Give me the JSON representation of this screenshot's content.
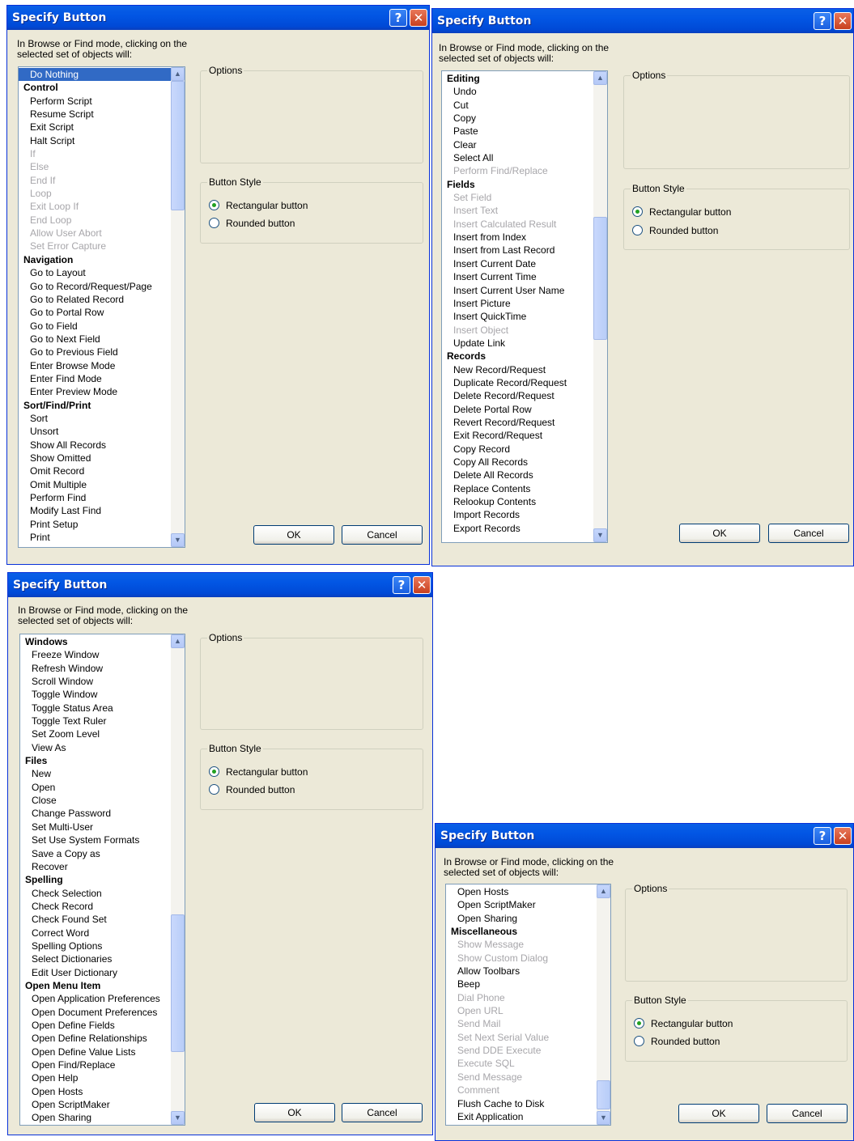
{
  "dialog_title": "Specify Button",
  "prompt": "In Browse or Find mode, clicking on the selected set of objects will:",
  "options_label": "Options",
  "button_style_label": "Button Style",
  "radio_rect": "Rectangular button",
  "radio_round": "Rounded button",
  "ok_label": "OK",
  "cancel_label": "Cancel",
  "help_glyph": "?",
  "close_glyph": "✕",
  "colors": {
    "titlebar": "#0054e3",
    "dialog_bg": "#ece9d8",
    "selection": "#316ac5"
  },
  "dialogs": [
    {
      "items": [
        {
          "text": "Do Nothing",
          "kind": "sel"
        },
        {
          "text": "Control",
          "kind": "hdr"
        },
        {
          "text": "Perform Script"
        },
        {
          "text": "Resume Script"
        },
        {
          "text": "Exit Script"
        },
        {
          "text": "Halt Script"
        },
        {
          "text": "If",
          "kind": "dis"
        },
        {
          "text": "Else",
          "kind": "dis"
        },
        {
          "text": "End If",
          "kind": "dis"
        },
        {
          "text": "Loop",
          "kind": "dis"
        },
        {
          "text": "Exit Loop If",
          "kind": "dis"
        },
        {
          "text": "End Loop",
          "kind": "dis"
        },
        {
          "text": "Allow User Abort",
          "kind": "dis"
        },
        {
          "text": "Set Error Capture",
          "kind": "dis"
        },
        {
          "text": "Navigation",
          "kind": "hdr"
        },
        {
          "text": "Go to Layout"
        },
        {
          "text": "Go to Record/Request/Page"
        },
        {
          "text": "Go to Related Record"
        },
        {
          "text": "Go to Portal Row"
        },
        {
          "text": "Go to Field"
        },
        {
          "text": "Go to Next Field"
        },
        {
          "text": "Go to Previous Field"
        },
        {
          "text": "Enter Browse Mode"
        },
        {
          "text": "Enter Find Mode"
        },
        {
          "text": "Enter Preview Mode"
        },
        {
          "text": "Sort/Find/Print",
          "kind": "hdr"
        },
        {
          "text": "Sort"
        },
        {
          "text": "Unsort"
        },
        {
          "text": "Show All Records"
        },
        {
          "text": "Show Omitted"
        },
        {
          "text": "Omit Record"
        },
        {
          "text": "Omit Multiple"
        },
        {
          "text": "Perform Find"
        },
        {
          "text": "Modify Last Find"
        },
        {
          "text": "Print Setup"
        },
        {
          "text": "Print"
        }
      ]
    },
    {
      "items": [
        {
          "text": "Editing",
          "kind": "hdr"
        },
        {
          "text": "Undo"
        },
        {
          "text": "Cut"
        },
        {
          "text": "Copy"
        },
        {
          "text": "Paste"
        },
        {
          "text": "Clear"
        },
        {
          "text": "Select All"
        },
        {
          "text": "Perform Find/Replace",
          "kind": "dis"
        },
        {
          "text": "Fields",
          "kind": "hdr"
        },
        {
          "text": "Set Field",
          "kind": "dis"
        },
        {
          "text": "Insert Text",
          "kind": "dis"
        },
        {
          "text": "Insert Calculated Result",
          "kind": "dis"
        },
        {
          "text": "Insert from Index"
        },
        {
          "text": "Insert from Last Record"
        },
        {
          "text": "Insert Current Date"
        },
        {
          "text": "Insert Current Time"
        },
        {
          "text": "Insert Current User Name"
        },
        {
          "text": "Insert Picture"
        },
        {
          "text": "Insert QuickTime"
        },
        {
          "text": "Insert Object",
          "kind": "dis"
        },
        {
          "text": "Update Link"
        },
        {
          "text": "Records",
          "kind": "hdr"
        },
        {
          "text": "New Record/Request"
        },
        {
          "text": "Duplicate Record/Request"
        },
        {
          "text": "Delete Record/Request"
        },
        {
          "text": "Delete Portal Row"
        },
        {
          "text": "Revert Record/Request"
        },
        {
          "text": "Exit Record/Request"
        },
        {
          "text": "Copy Record"
        },
        {
          "text": "Copy All Records"
        },
        {
          "text": "Delete All Records"
        },
        {
          "text": "Replace Contents"
        },
        {
          "text": "Relookup Contents"
        },
        {
          "text": "Import Records"
        },
        {
          "text": "Export Records"
        }
      ]
    },
    {
      "items": [
        {
          "text": "Windows",
          "kind": "hdr"
        },
        {
          "text": "Freeze Window"
        },
        {
          "text": "Refresh Window"
        },
        {
          "text": "Scroll Window"
        },
        {
          "text": "Toggle Window"
        },
        {
          "text": "Toggle Status Area"
        },
        {
          "text": "Toggle Text Ruler"
        },
        {
          "text": "Set Zoom Level"
        },
        {
          "text": "View As"
        },
        {
          "text": "Files",
          "kind": "hdr"
        },
        {
          "text": "New"
        },
        {
          "text": "Open"
        },
        {
          "text": "Close"
        },
        {
          "text": "Change Password"
        },
        {
          "text": "Set Multi-User"
        },
        {
          "text": "Set Use System Formats"
        },
        {
          "text": "Save a Copy as"
        },
        {
          "text": "Recover"
        },
        {
          "text": "Spelling",
          "kind": "hdr"
        },
        {
          "text": "Check Selection"
        },
        {
          "text": "Check Record"
        },
        {
          "text": "Check Found Set"
        },
        {
          "text": "Correct Word"
        },
        {
          "text": "Spelling Options"
        },
        {
          "text": "Select Dictionaries"
        },
        {
          "text": "Edit User Dictionary"
        },
        {
          "text": "Open Menu Item",
          "kind": "hdr"
        },
        {
          "text": "Open Application Preferences"
        },
        {
          "text": "Open Document Preferences"
        },
        {
          "text": "Open Define Fields"
        },
        {
          "text": "Open Define Relationships"
        },
        {
          "text": "Open Define Value Lists"
        },
        {
          "text": "Open Find/Replace"
        },
        {
          "text": "Open Help"
        },
        {
          "text": "Open Hosts"
        },
        {
          "text": "Open ScriptMaker"
        },
        {
          "text": "Open Sharing"
        }
      ]
    },
    {
      "items": [
        {
          "text": "Open Hosts"
        },
        {
          "text": "Open ScriptMaker"
        },
        {
          "text": "Open Sharing"
        },
        {
          "text": "Miscellaneous",
          "kind": "hdr"
        },
        {
          "text": "Show Message",
          "kind": "dis"
        },
        {
          "text": "Show Custom Dialog",
          "kind": "dis"
        },
        {
          "text": "Allow Toolbars"
        },
        {
          "text": "Beep"
        },
        {
          "text": "Dial Phone",
          "kind": "dis"
        },
        {
          "text": "Open URL",
          "kind": "dis"
        },
        {
          "text": "Send Mail",
          "kind": "dis"
        },
        {
          "text": "Set Next Serial Value",
          "kind": "dis"
        },
        {
          "text": "Send DDE Execute",
          "kind": "dis"
        },
        {
          "text": "Execute SQL",
          "kind": "dis"
        },
        {
          "text": "Send Message",
          "kind": "dis"
        },
        {
          "text": "Comment",
          "kind": "dis"
        },
        {
          "text": "Flush Cache to Disk"
        },
        {
          "text": "Exit Application"
        }
      ]
    }
  ]
}
